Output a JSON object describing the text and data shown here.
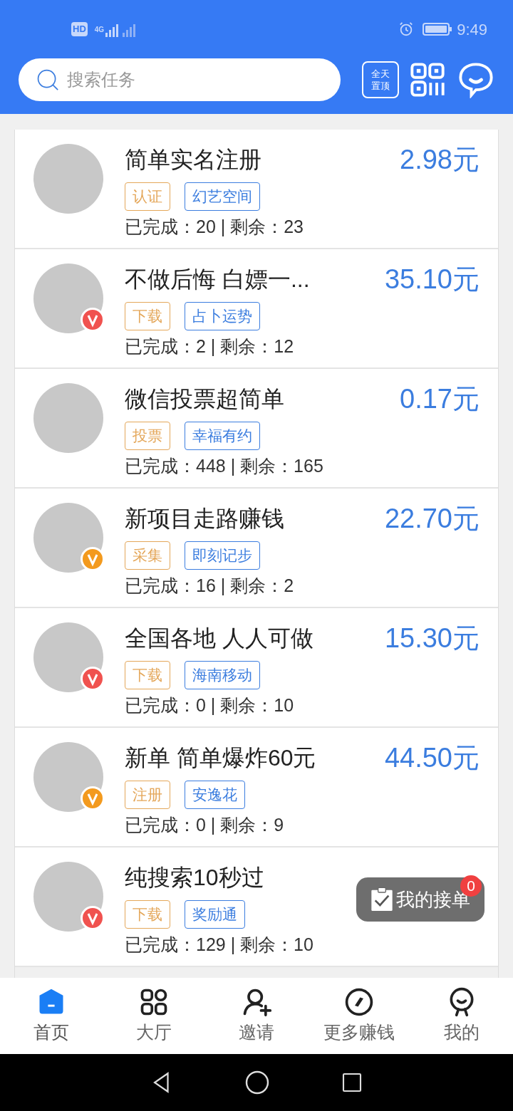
{
  "status_bar": {
    "hd": "HD",
    "network": "4G",
    "time": "9:49"
  },
  "header": {
    "search": {
      "placeholder": "搜索任务"
    },
    "pin_button": "全天置顶"
  },
  "tasks": [
    {
      "title": "简单实名注册",
      "price": "2.98元",
      "tags": [
        "认证",
        "幻艺空间"
      ],
      "stats": "已完成：20 | 剩余：23"
    },
    {
      "title": "不做后悔  白嫖一...",
      "price": "35.10元",
      "tags": [
        "下载",
        "占卜运势"
      ],
      "stats": "已完成：2 | 剩余：12",
      "badge": {
        "color": "#f0524f"
      }
    },
    {
      "title": "微信投票超简单",
      "price": "0.17元",
      "tags": [
        "投票",
        "幸福有约"
      ],
      "stats": "已完成：448 | 剩余：165"
    },
    {
      "title": "新项目走路赚钱",
      "price": "22.70元",
      "tags": [
        "采集",
        "即刻记步"
      ],
      "stats": "已完成：16 | 剩余：2",
      "badge": {
        "color": "#f39a1e"
      }
    },
    {
      "title": "全国各地  人人可做",
      "price": "15.30元",
      "tags": [
        "下载",
        "海南移动"
      ],
      "stats": "已完成：0 | 剩余：10",
      "badge": {
        "color": "#f0524f"
      }
    },
    {
      "title": "新单 简单爆炸60元",
      "price": "44.50元",
      "tags": [
        "注册",
        "安逸花"
      ],
      "stats": "已完成：0 | 剩余：9",
      "badge": {
        "color": "#f39a1e"
      }
    },
    {
      "title": "纯搜索10秒过",
      "tags": [
        "下载",
        "奖励通"
      ],
      "stats": "已完成：129 | 剩余：10",
      "badge": {
        "color": "#f0524f"
      }
    }
  ],
  "floating_button": {
    "label": "我的接单",
    "count": "0"
  },
  "bottom_nav": [
    {
      "label": "首页",
      "selected": true
    },
    {
      "label": "大厅",
      "selected": false
    },
    {
      "label": "邀请",
      "selected": false
    },
    {
      "label": "更多赚钱",
      "selected": false
    },
    {
      "label": "我的",
      "selected": false
    }
  ]
}
